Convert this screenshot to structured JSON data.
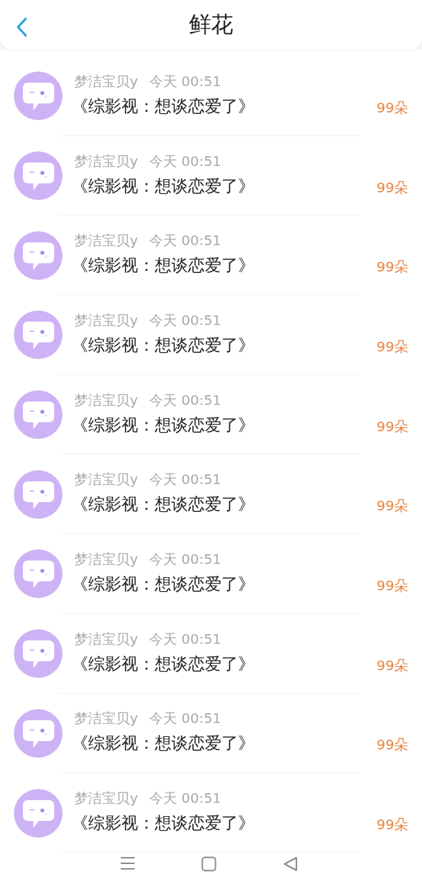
{
  "header": {
    "title": "鲜花"
  },
  "items": [
    {
      "name": "梦洁宝贝y",
      "time": "今天 00:51",
      "title": "《综影视：想谈恋爱了》",
      "amount": "99朵"
    },
    {
      "name": "梦洁宝贝y",
      "time": "今天 00:51",
      "title": "《综影视：想谈恋爱了》",
      "amount": "99朵"
    },
    {
      "name": "梦洁宝贝y",
      "time": "今天 00:51",
      "title": "《综影视：想谈恋爱了》",
      "amount": "99朵"
    },
    {
      "name": "梦洁宝贝y",
      "time": "今天 00:51",
      "title": "《综影视：想谈恋爱了》",
      "amount": "99朵"
    },
    {
      "name": "梦洁宝贝y",
      "time": "今天 00:51",
      "title": "《综影视：想谈恋爱了》",
      "amount": "99朵"
    },
    {
      "name": "梦洁宝贝y",
      "time": "今天 00:51",
      "title": "《综影视：想谈恋爱了》",
      "amount": "99朵"
    },
    {
      "name": "梦洁宝贝y",
      "time": "今天 00:51",
      "title": "《综影视：想谈恋爱了》",
      "amount": "99朵"
    },
    {
      "name": "梦洁宝贝y",
      "time": "今天 00:51",
      "title": "《综影视：想谈恋爱了》",
      "amount": "99朵"
    },
    {
      "name": "梦洁宝贝y",
      "time": "今天 00:51",
      "title": "《综影视：想谈恋爱了》",
      "amount": "99朵"
    },
    {
      "name": "梦洁宝贝y",
      "time": "今天 00:51",
      "title": "《综影视：想谈恋爱了》",
      "amount": "99朵"
    }
  ]
}
